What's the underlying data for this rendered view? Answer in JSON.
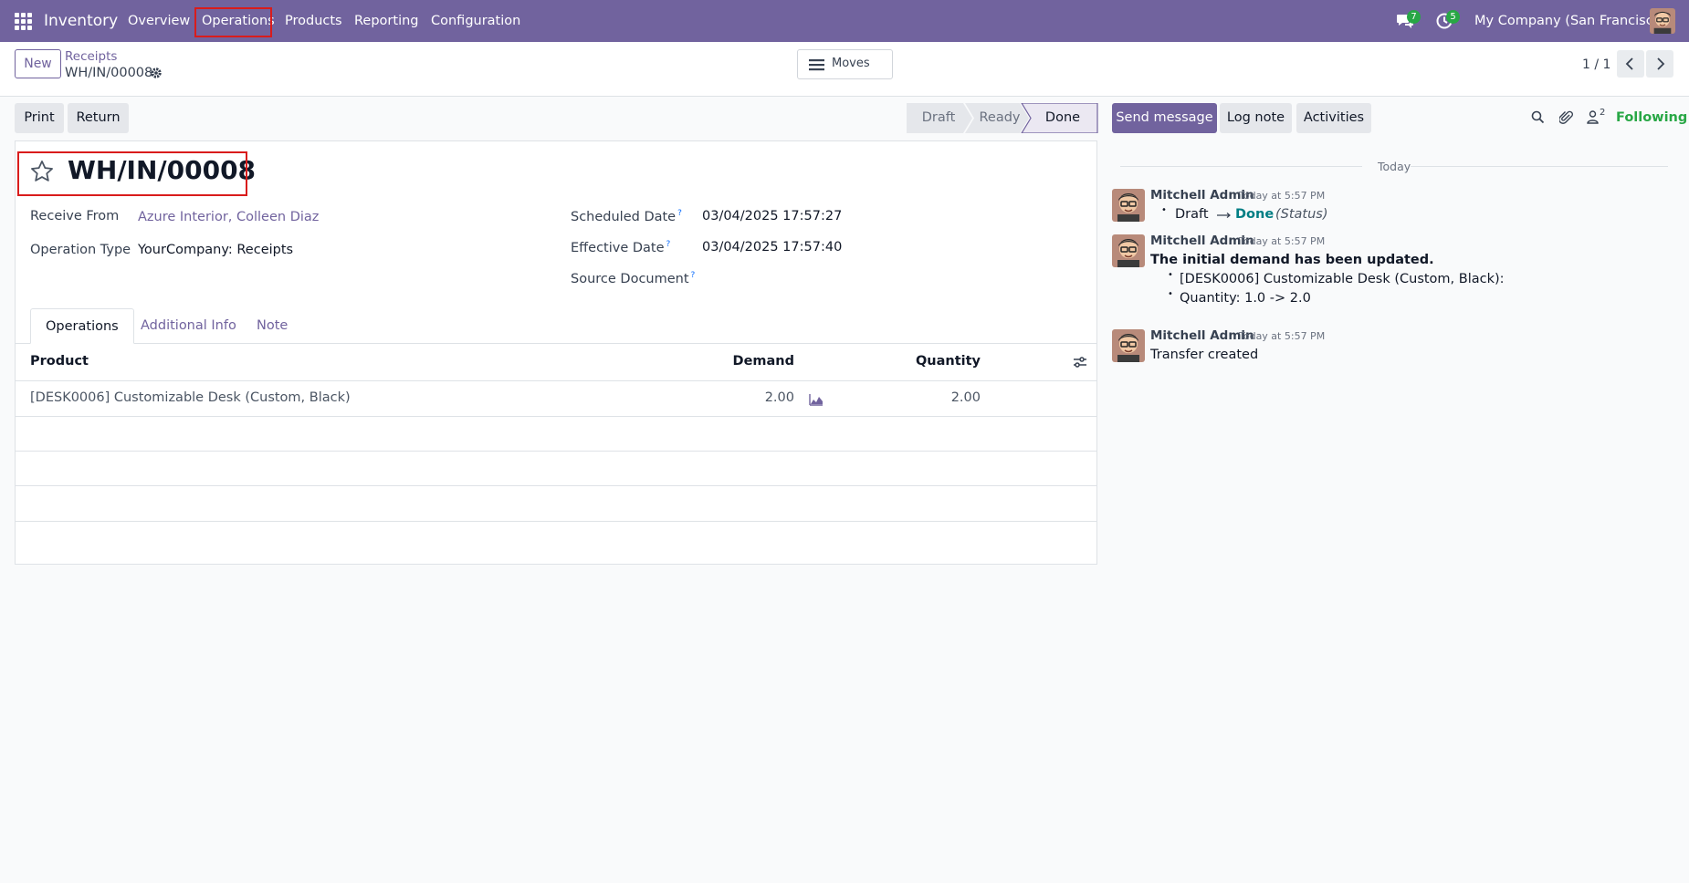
{
  "navbar": {
    "app_name": "Inventory",
    "menu": [
      "Overview",
      "Operations",
      "Products",
      "Reporting",
      "Configuration"
    ],
    "messages_count": "7",
    "activities_count": "5",
    "company": "My Company (San Francisco)"
  },
  "control_panel": {
    "new_label": "New",
    "breadcrumb_parent": "Receipts",
    "breadcrumb_current": "WH/IN/00008",
    "moves_label": "Moves",
    "pager": "1 / 1"
  },
  "actions": {
    "print": "Print",
    "return": "Return"
  },
  "status": {
    "stages": [
      "Draft",
      "Ready",
      "Done"
    ],
    "current": "Done"
  },
  "form": {
    "title": "WH/IN/00008",
    "receive_from_label": "Receive From",
    "receive_from_value": "Azure Interior, Colleen Diaz",
    "operation_type_label": "Operation Type",
    "operation_type_value": "YourCompany: Receipts",
    "scheduled_date_label": "Scheduled Date",
    "scheduled_date_value": "03/04/2025 17:57:27",
    "effective_date_label": "Effective Date",
    "effective_date_value": "03/04/2025 17:57:40",
    "source_document_label": "Source Document",
    "help_marker": "?",
    "tabs": [
      "Operations",
      "Additional Info",
      "Note"
    ],
    "table": {
      "headers": [
        "Product",
        "Demand",
        "Quantity"
      ],
      "rows": [
        {
          "product": "[DESK0006] Customizable Desk (Custom, Black)",
          "demand": "2.00",
          "quantity": "2.00"
        }
      ]
    }
  },
  "chatter": {
    "send_message": "Send message",
    "log_note": "Log note",
    "activities": "Activities",
    "followers_count": "2",
    "following": "Following",
    "date_separator": "Today",
    "messages": [
      {
        "author": "Mitchell Admin",
        "time": "Today at 5:57 PM",
        "from": "Draft",
        "to": "Done",
        "field": "(Status)"
      },
      {
        "author": "Mitchell Admin",
        "time": "Today at 5:57 PM",
        "heading": "The initial demand has been updated.",
        "bullets": [
          "[DESK0006] Customizable Desk (Custom, Black):",
          "Quantity: 1.0 -> 2.0"
        ]
      },
      {
        "author": "Mitchell Admin",
        "time": "Today at 5:57 PM",
        "body": "Transfer created"
      }
    ]
  },
  "colors": {
    "brand": "#71639e",
    "highlight": "#d91c1c",
    "success": "#28a745",
    "info": "#017e84"
  }
}
